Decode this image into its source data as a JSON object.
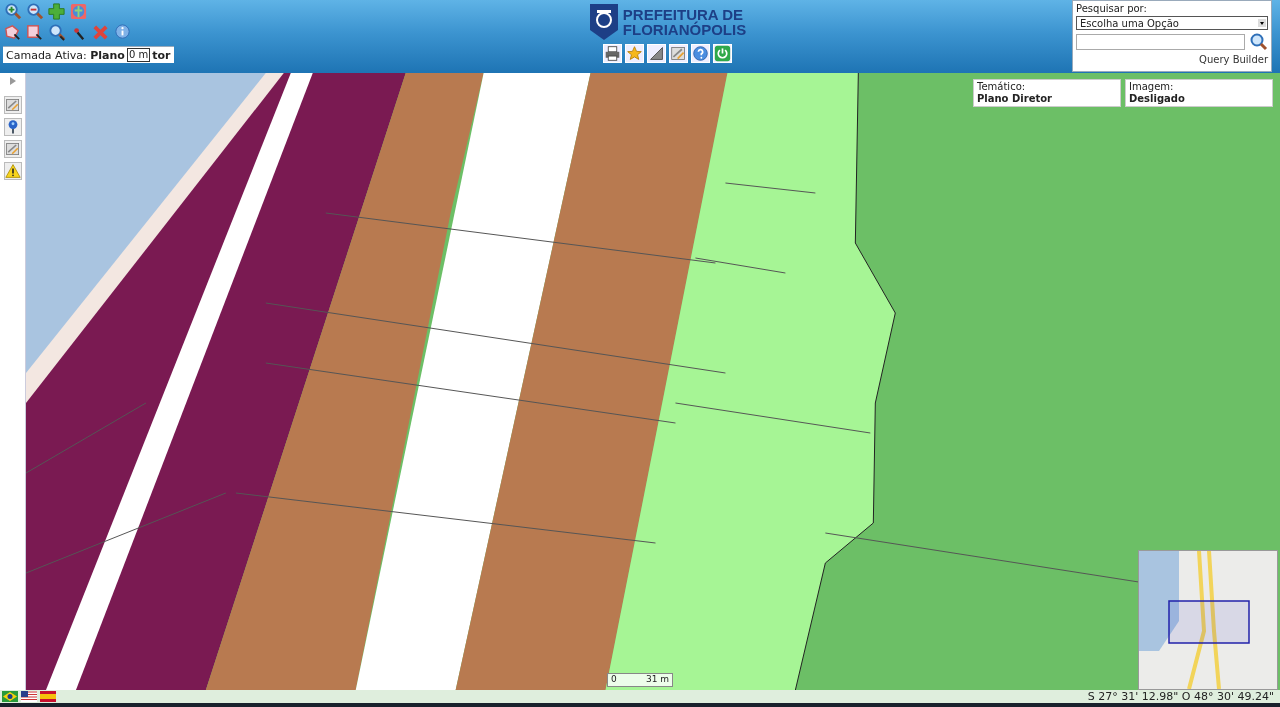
{
  "header": {
    "active_layer": {
      "label": "Camada Ativa:",
      "value_start": "Plano",
      "tooltip": "0 m",
      "value_end": "tor"
    },
    "logo": {
      "line1": "PREFEITURA DE",
      "line2": "FLORIANÓPOLIS"
    }
  },
  "search": {
    "label": "Pesquisar por:",
    "select_value": "Escolha uma Opção",
    "link": "Query Builder"
  },
  "map": {
    "info_panels": [
      {
        "label": "Temático:",
        "value": "Plano Diretor"
      },
      {
        "label": "Imagem:",
        "value": "Desligado"
      }
    ],
    "scale": {
      "start": "0",
      "end": "31 m"
    }
  },
  "status_bar": {
    "coordinates": "S 27° 31' 12.98\" O 48° 30' 49.24\""
  }
}
